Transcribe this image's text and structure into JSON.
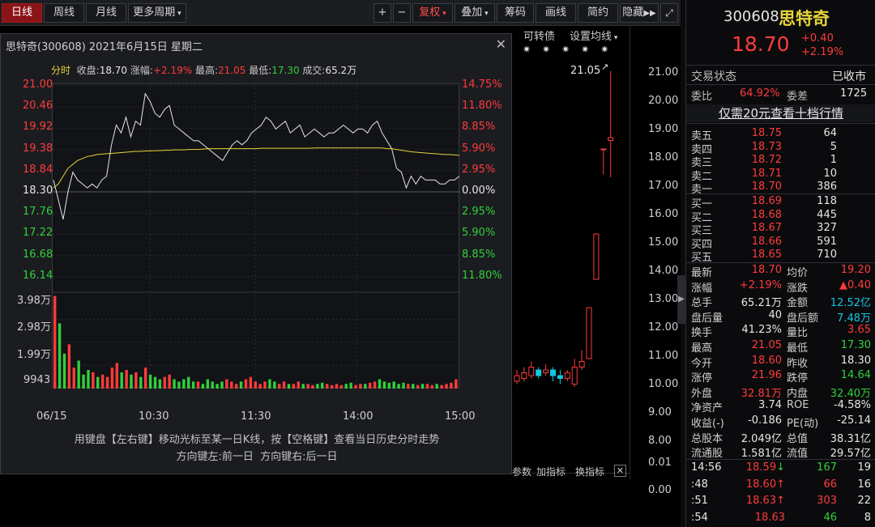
{
  "toolbar": {
    "left_buttons": [
      {
        "label": "日线",
        "active": true
      },
      {
        "label": "周线"
      },
      {
        "label": "月线"
      },
      {
        "label": "更多周期",
        "dropdown": true
      }
    ],
    "plus_label": "+",
    "minus_label": "−",
    "right_buttons": [
      {
        "label": "复权",
        "dropdown": true,
        "highlight": true
      },
      {
        "label": "叠加",
        "dropdown": true
      },
      {
        "label": "筹码"
      },
      {
        "label": "画线"
      },
      {
        "label": "简约"
      },
      {
        "label": "隐藏",
        "arrow": true
      }
    ]
  },
  "chart_strip": {
    "convertible_label": "可转债",
    "set_ma_label": "设置均线"
  },
  "price_axis": [
    "21.00",
    "20.00",
    "19.00",
    "18.00",
    "17.00",
    "16.00",
    "15.00",
    "14.00",
    "13.00",
    "12.00",
    "11.00",
    "10.00",
    "9.00",
    "8.00"
  ],
  "volume_axis": [
    "0.01",
    "0.00"
  ],
  "kline_high_label": "21.05",
  "indicator_bar": {
    "params": "参数",
    "add": "加指标",
    "switch": "换指标"
  },
  "popup": {
    "title": "思特奇(300608) 2021年6月15日 星期二",
    "info": {
      "label": "分时",
      "close_label": "收盘:",
      "close": "18.70",
      "change_label": "涨幅:",
      "change": "+2.19%",
      "high_label": "最高:",
      "high": "21.05",
      "low_label": "最低:",
      "low": "17.30",
      "vol_label": "成交:",
      "vol": "65.2万"
    },
    "hint1": "用键盘【左右键】移动光标至某一日K线，按【空格键】查看当日历史分时走势",
    "hint2": "方向键左:前一日  方向键右:后一日"
  },
  "chart_data": {
    "type": "line",
    "x_labels": [
      "06/15",
      "10:30",
      "11:30",
      "14:00",
      "15:00"
    ],
    "price_ylim": [
      16.14,
      21.0
    ],
    "price_ticks_left": [
      "21.00",
      "20.46",
      "19.92",
      "19.38",
      "18.84",
      "18.30",
      "17.76",
      "17.22",
      "16.68",
      "16.14"
    ],
    "pct_ticks_right": [
      "14.75%",
      "11.80%",
      "8.85%",
      "5.90%",
      "2.95%",
      "0.00%",
      "2.95%",
      "5.90%",
      "8.85%",
      "11.80%"
    ],
    "prev_close": 18.3,
    "volume_ticks": [
      "3.98万",
      "2.98万",
      "1.99万",
      "9943"
    ],
    "series": [
      {
        "role": "price",
        "values": [
          18.6,
          18.1,
          17.6,
          18.3,
          18.8,
          18.6,
          18.5,
          18.4,
          18.5,
          18.4,
          18.6,
          18.7,
          19.5,
          20.0,
          19.8,
          20.2,
          19.7,
          20.1,
          20.0,
          20.8,
          20.6,
          20.3,
          20.2,
          20.4,
          20.5,
          20.0,
          19.9,
          19.8,
          19.7,
          19.6,
          19.6,
          19.5,
          19.4,
          19.3,
          19.2,
          19.1,
          19.3,
          19.5,
          19.6,
          19.5,
          19.6,
          19.8,
          19.9,
          20.0,
          20.2,
          20.1,
          19.9,
          20.0,
          20.1,
          19.8,
          19.9,
          20.0,
          19.7,
          19.8,
          19.9,
          19.8,
          19.7,
          19.8,
          19.8,
          19.9,
          20.0,
          19.9,
          19.8,
          19.9,
          19.9,
          19.8,
          20.0,
          20.1,
          19.8,
          19.6,
          19.4,
          18.9,
          18.8,
          18.4,
          18.7,
          18.5,
          18.7,
          18.6,
          18.6,
          18.6,
          18.5,
          18.5,
          18.6,
          18.6,
          18.7
        ]
      },
      {
        "role": "average",
        "values": [
          18.4,
          18.5,
          18.7,
          18.9,
          19.0,
          19.1,
          19.15,
          19.2,
          19.22,
          19.25,
          19.26,
          19.27,
          19.28,
          19.29,
          19.3,
          19.31,
          19.32,
          19.33,
          19.33,
          19.34,
          19.34,
          19.35,
          19.35,
          19.36,
          19.36,
          19.37,
          19.37,
          19.37,
          19.38,
          19.38,
          19.38,
          19.39,
          19.4,
          19.4,
          19.4,
          19.4,
          19.4,
          19.4,
          19.4,
          19.4,
          19.4,
          19.4,
          19.4,
          19.41,
          19.41,
          19.41,
          19.41,
          19.41,
          19.41,
          19.41,
          19.41,
          19.41,
          19.41,
          19.41,
          19.42,
          19.42,
          19.42,
          19.42,
          19.42,
          19.42,
          19.42,
          19.42,
          19.42,
          19.42,
          19.42,
          19.42,
          19.42,
          19.42,
          19.42,
          19.4,
          19.4,
          19.38,
          19.36,
          19.34,
          19.32,
          19.31,
          19.3,
          19.29,
          19.28,
          19.27,
          19.26,
          19.25,
          19.25,
          19.24,
          19.23
        ]
      }
    ],
    "volume_ylim": [
      0,
      40000
    ],
    "volume": [
      39800,
      28000,
      15000,
      19000,
      9000,
      12000,
      6000,
      8000,
      7000,
      5000,
      6000,
      5000,
      9000,
      11000,
      7000,
      8000,
      6000,
      7000,
      5000,
      9000,
      6000,
      5000,
      4000,
      5000,
      6000,
      4000,
      3000,
      4000,
      5000,
      3000,
      3000,
      2000,
      4000,
      3000,
      2000,
      3000,
      4000,
      3000,
      2000,
      3000,
      4000,
      5000,
      3000,
      2000,
      3000,
      4000,
      3000,
      2000,
      3000,
      2000,
      2000,
      3000,
      2000,
      2000,
      1500,
      2000,
      2500,
      2000,
      1500,
      2000,
      1500,
      2000,
      2500,
      1500,
      2000,
      2000,
      2500,
      3000,
      4000,
      3000,
      2500,
      3000,
      2000,
      2500,
      2000,
      2000,
      1500,
      2000,
      2000,
      1500,
      2000,
      1500,
      2000,
      2500,
      4000
    ]
  },
  "kline": {
    "ylim": [
      7.5,
      21.5
    ],
    "candles": [
      {
        "o": 10.1,
        "c": 10.3,
        "h": 10.5,
        "l": 10.0
      },
      {
        "o": 10.2,
        "c": 10.4,
        "h": 10.6,
        "l": 10.1
      },
      {
        "o": 10.3,
        "c": 10.6,
        "h": 10.8,
        "l": 10.2
      },
      {
        "o": 10.5,
        "c": 10.3,
        "h": 10.6,
        "l": 10.2
      },
      {
        "o": 10.4,
        "c": 10.5,
        "h": 10.7,
        "l": 10.3
      },
      {
        "o": 10.5,
        "c": 10.3,
        "h": 10.6,
        "l": 10.1
      },
      {
        "o": 10.3,
        "c": 10.2,
        "h": 10.5,
        "l": 10.0
      },
      {
        "o": 10.2,
        "c": 10.4,
        "h": 10.5,
        "l": 10.1
      },
      {
        "o": 10.0,
        "c": 10.6,
        "h": 10.9,
        "l": 9.9
      },
      {
        "o": 10.6,
        "c": 10.8,
        "h": 11.2,
        "l": 10.5
      },
      {
        "o": 10.9,
        "c": 12.7,
        "h": 12.7,
        "l": 10.9
      },
      {
        "o": 13.7,
        "c": 15.3,
        "h": 15.3,
        "l": 13.7
      },
      {
        "o": 18.3,
        "c": 18.3,
        "h": 18.3,
        "l": 17.4
      },
      {
        "o": 18.6,
        "c": 18.7,
        "h": 21.05,
        "l": 17.3
      }
    ]
  },
  "quote": {
    "code": "300608",
    "name": "思特奇",
    "price": "18.70",
    "change": "+0.40",
    "pct": "+2.19%",
    "trade_status_label": "交易状态",
    "trade_status": "已收市",
    "wb_label": "委比",
    "wb": "64.92%",
    "wc_label": "委差",
    "wc": "1725",
    "ten_level_link": "仅需20元查看十档行情"
  },
  "orderbook": {
    "asks": [
      {
        "label": "卖五",
        "price": "18.75",
        "vol": "64"
      },
      {
        "label": "卖四",
        "price": "18.73",
        "vol": "5"
      },
      {
        "label": "卖三",
        "price": "18.72",
        "vol": "1"
      },
      {
        "label": "卖二",
        "price": "18.71",
        "vol": "10"
      },
      {
        "label": "卖一",
        "price": "18.70",
        "vol": "386"
      }
    ],
    "bids": [
      {
        "label": "买一",
        "price": "18.69",
        "vol": "118"
      },
      {
        "label": "买二",
        "price": "18.68",
        "vol": "445"
      },
      {
        "label": "买三",
        "price": "18.67",
        "vol": "327"
      },
      {
        "label": "买四",
        "price": "18.66",
        "vol": "591"
      },
      {
        "label": "买五",
        "price": "18.65",
        "vol": "710"
      }
    ]
  },
  "stats": [
    {
      "k1": "最新",
      "v1": "18.70",
      "c1": "red",
      "k2": "均价",
      "v2": "19.20",
      "c2": "red"
    },
    {
      "k1": "涨幅",
      "v1": "+2.19%",
      "c1": "red",
      "k2": "涨跌",
      "v2": "▲0.40",
      "c2": "red"
    },
    {
      "k1": "总手",
      "v1": "65.21万",
      "c1": "white",
      "k2": "金额",
      "v2": "12.52亿",
      "c2": "cyan"
    },
    {
      "k1": "盘后量",
      "v1": "40",
      "c1": "white",
      "k2": "盘后额",
      "v2": "7.48万",
      "c2": "cyan"
    },
    {
      "k1": "换手",
      "v1": "41.23%",
      "c1": "white",
      "k2": "量比",
      "v2": "3.65",
      "c2": "red"
    },
    {
      "k1": "最高",
      "v1": "21.05",
      "c1": "red",
      "k2": "最低",
      "v2": "17.30",
      "c2": "green"
    },
    {
      "k1": "今开",
      "v1": "18.60",
      "c1": "red",
      "k2": "昨收",
      "v2": "18.30",
      "c2": "white"
    },
    {
      "k1": "涨停",
      "v1": "21.96",
      "c1": "red",
      "k2": "跌停",
      "v2": "14.64",
      "c2": "green"
    },
    {
      "k1": "外盘",
      "v1": "32.81万",
      "c1": "red",
      "k2": "内盘",
      "v2": "32.40万",
      "c2": "green"
    },
    {
      "k1": "净资产",
      "v1": "3.74",
      "c1": "white",
      "k2": "ROE",
      "v2": "-4.58%",
      "c2": "white"
    },
    {
      "k1": "收益(-)",
      "v1": "-0.186",
      "c1": "white",
      "k2": "PE(动)",
      "v2": "-25.14",
      "c2": "white"
    },
    {
      "k1": "总股本",
      "v1": "2.049亿",
      "c1": "white",
      "k2": "总值",
      "v2": "38.31亿",
      "c2": "white"
    },
    {
      "k1": "流通股",
      "v1": "1.581亿",
      "c1": "white",
      "k2": "流值",
      "v2": "29.57亿",
      "c2": "white"
    }
  ],
  "ticks": [
    {
      "time": "14:56",
      "price": "18.59",
      "arrow": "↓",
      "ac": "green",
      "vol": "167",
      "vc": "green",
      "n": "19"
    },
    {
      "time": ":48",
      "price": "18.60",
      "arrow": "↑",
      "ac": "red",
      "vol": "66",
      "vc": "red",
      "n": "16"
    },
    {
      "time": ":51",
      "price": "18.63",
      "arrow": "↑",
      "ac": "red",
      "vol": "303",
      "vc": "red",
      "n": "22"
    },
    {
      "time": ":54",
      "price": "18.63",
      "arrow": "",
      "ac": "red",
      "vol": "46",
      "vc": "green",
      "n": "8"
    }
  ],
  "colors": {
    "up": "#ff3b3b",
    "down": "#2fd13a",
    "avg": "#e6d43a",
    "price_line": "#e6e6e6",
    "cyan": "#12c8e0",
    "active": "#8a1418"
  }
}
